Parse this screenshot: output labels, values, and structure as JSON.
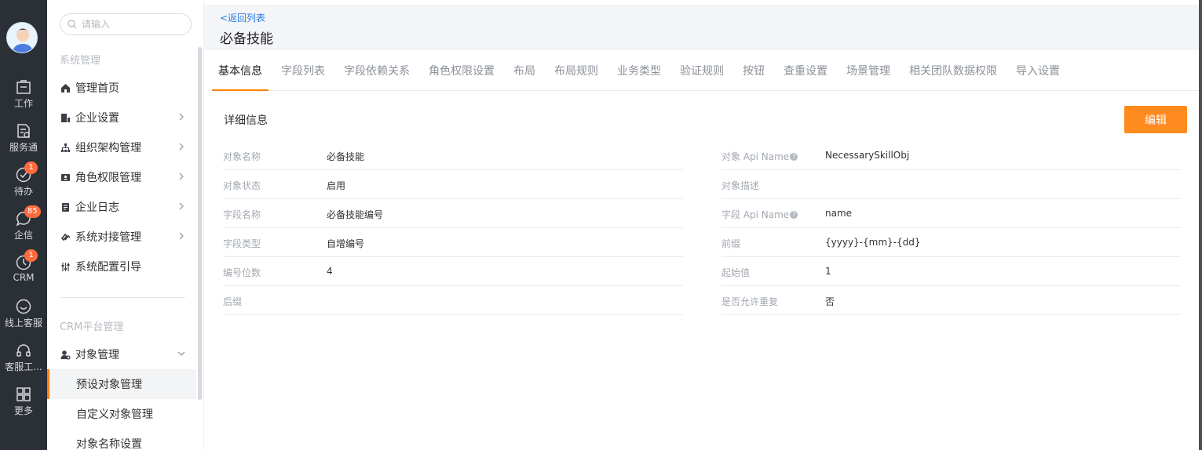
{
  "rail": {
    "items": [
      {
        "label": "工作",
        "icon": "work-icon"
      },
      {
        "label": "服务通",
        "icon": "service-icon"
      },
      {
        "label": "待办",
        "icon": "todo-icon",
        "badge": "1"
      },
      {
        "label": "企信",
        "icon": "chat-icon",
        "badge": "85"
      },
      {
        "label": "CRM",
        "icon": "crm-icon",
        "badge": "1"
      },
      {
        "label": "线上客服",
        "icon": "online-service-icon"
      },
      {
        "label": "客服工...",
        "icon": "headset-icon"
      },
      {
        "label": "更多",
        "icon": "grid-icon"
      }
    ]
  },
  "sidebar": {
    "search_placeholder": "请输入",
    "section1": "系统管理",
    "items": [
      {
        "label": "管理首页",
        "icon": "home-icon"
      },
      {
        "label": "企业设置",
        "icon": "enterprise-icon"
      },
      {
        "label": "组织架构管理",
        "icon": "org-icon"
      },
      {
        "label": "角色权限管理",
        "icon": "role-icon"
      },
      {
        "label": "企业日志",
        "icon": "log-icon"
      },
      {
        "label": "系统对接管理",
        "icon": "link-icon"
      },
      {
        "label": "系统配置引导",
        "icon": "config-icon"
      }
    ],
    "section2": "CRM平台管理",
    "object_mgmt": "对象管理",
    "sub": [
      "预设对象管理",
      "自定义对象管理",
      "对象名称设置"
    ]
  },
  "header": {
    "back": "<返回列表",
    "title": "必备技能"
  },
  "tabs": [
    "基本信息",
    "字段列表",
    "字段依赖关系",
    "角色权限设置",
    "布局",
    "布局规则",
    "业务类型",
    "验证规则",
    "按钮",
    "查重设置",
    "场景管理",
    "相关团队数据权限",
    "导入设置"
  ],
  "detail": {
    "title": "详细信息",
    "edit": "编辑",
    "left": [
      {
        "label": "对象名称",
        "value": "必备技能"
      },
      {
        "label": "对象状态",
        "value": "启用"
      },
      {
        "label": "字段名称",
        "value": "必备技能编号"
      },
      {
        "label": "字段类型",
        "value": "自增编号"
      },
      {
        "label": "编号位数",
        "value": "4"
      },
      {
        "label": "后缀",
        "value": ""
      }
    ],
    "right": [
      {
        "label": "对象 Api Name",
        "value": "NecessarySkillObj",
        "help": true
      },
      {
        "label": "对象描述",
        "value": ""
      },
      {
        "label": "字段 Api Name",
        "value": "name",
        "help": true
      },
      {
        "label": "前缀",
        "value": "{yyyy}-{mm}-{dd}"
      },
      {
        "label": "起始值",
        "value": "1"
      },
      {
        "label": "是否允许重复",
        "value": "否"
      }
    ]
  },
  "colors": {
    "accent": "#ff8a1e",
    "link": "#2c7be5",
    "rail": "#2b2f36"
  }
}
